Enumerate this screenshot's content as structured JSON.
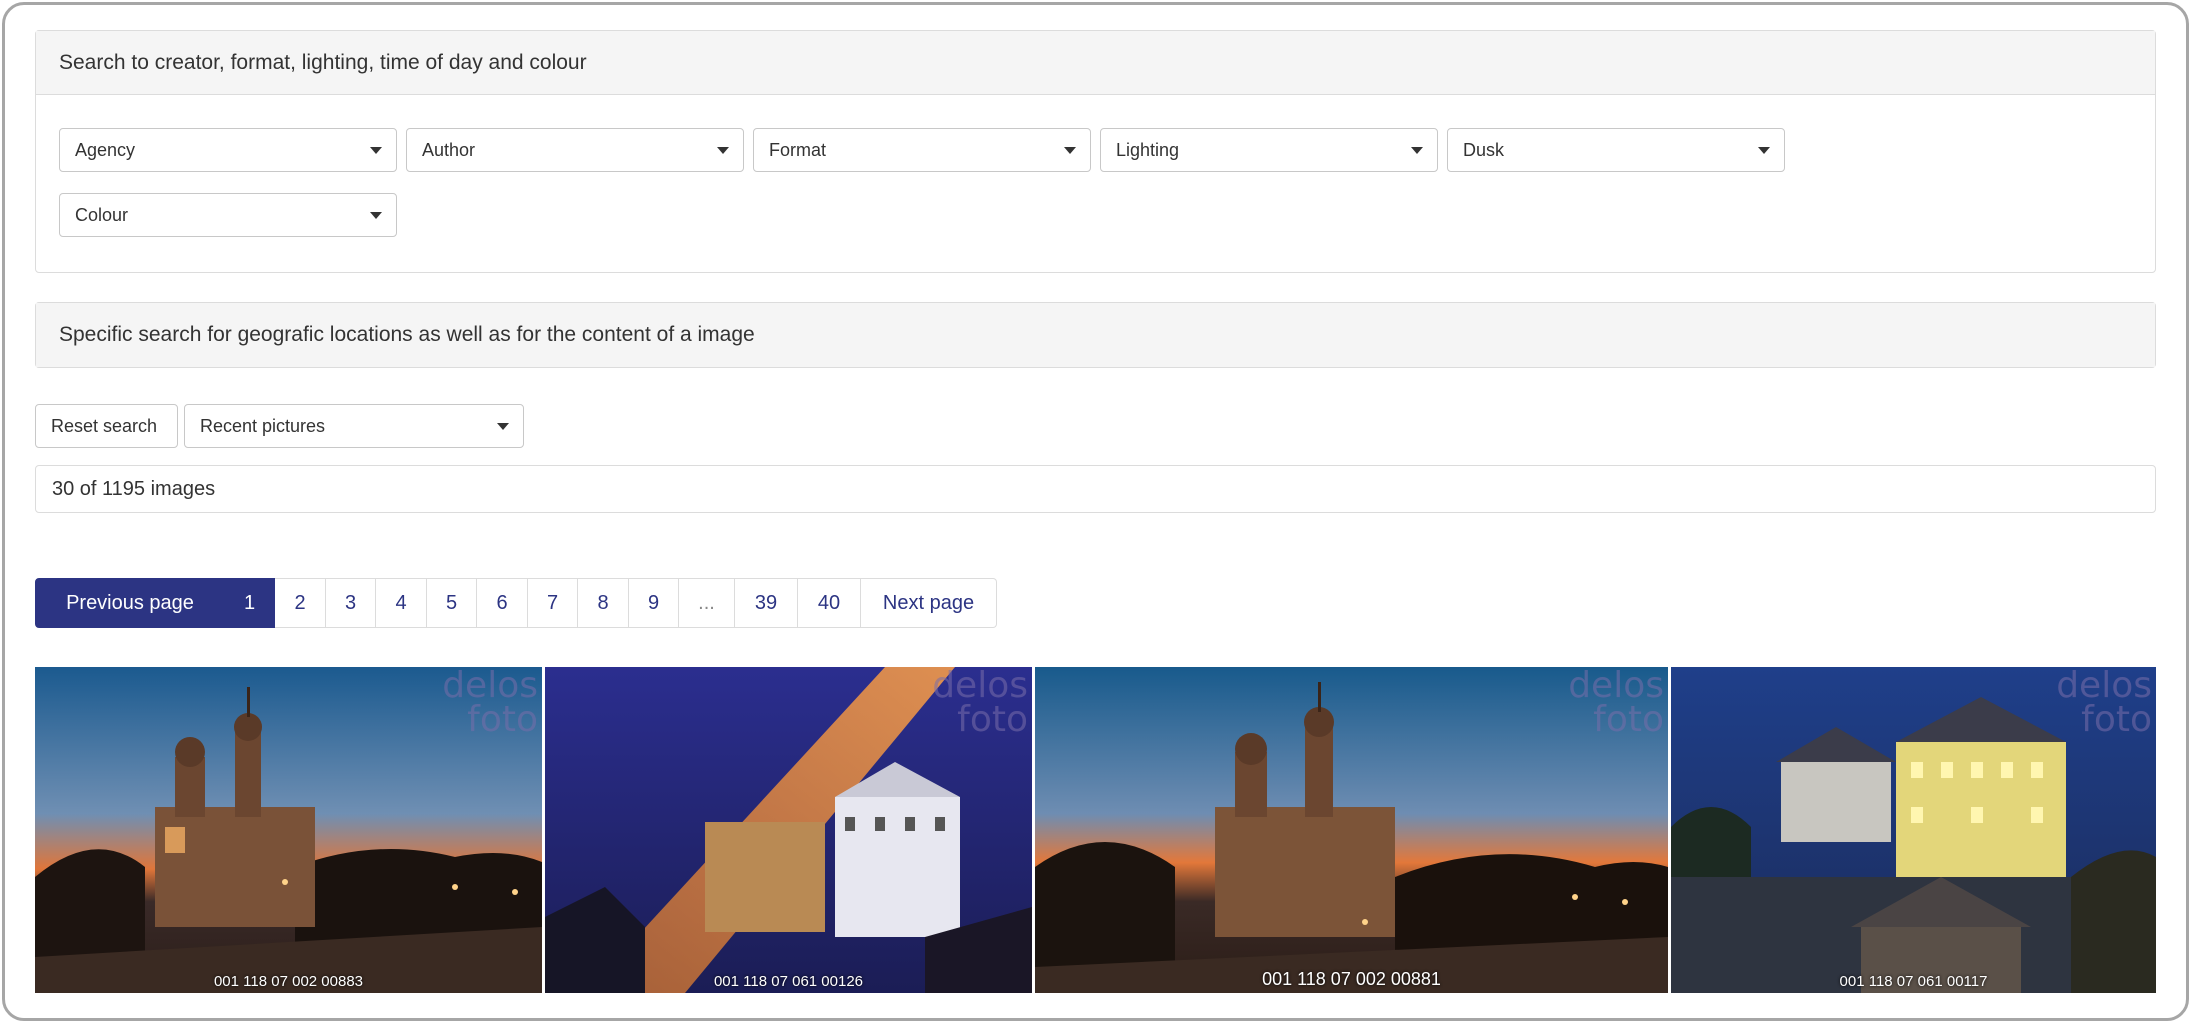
{
  "panel1": {
    "title": "Search to creator, format, lighting, time of day and colour",
    "selects": [
      "Agency",
      "Author",
      "Format",
      "Lighting",
      "Dusk",
      "Colour"
    ]
  },
  "panel2": {
    "title": "Specific search for geografic locations as well as for the content of a image"
  },
  "toolbar": {
    "reset_label": "Reset search",
    "sort_value": "Recent pictures"
  },
  "results": {
    "count_text": "30 of 1195 images"
  },
  "pagination": {
    "prev_label": "Previous page",
    "pages": [
      "1",
      "2",
      "3",
      "4",
      "5",
      "6",
      "7",
      "8",
      "9",
      "...",
      "39",
      "40"
    ],
    "next_label": "Next page",
    "active_page": "1"
  },
  "gallery": {
    "watermark": [
      "delos",
      "foto"
    ],
    "images": [
      {
        "caption": "001 118 07 002 00883"
      },
      {
        "caption": "001 118 07 061 00126"
      },
      {
        "caption": "001 118 07 002 00881"
      },
      {
        "caption": "001 118 07 061 00117"
      }
    ]
  },
  "colors": {
    "accent": "#2c3483",
    "panel_header_bg": "#f5f5f5",
    "border": "#dcdcdc"
  }
}
